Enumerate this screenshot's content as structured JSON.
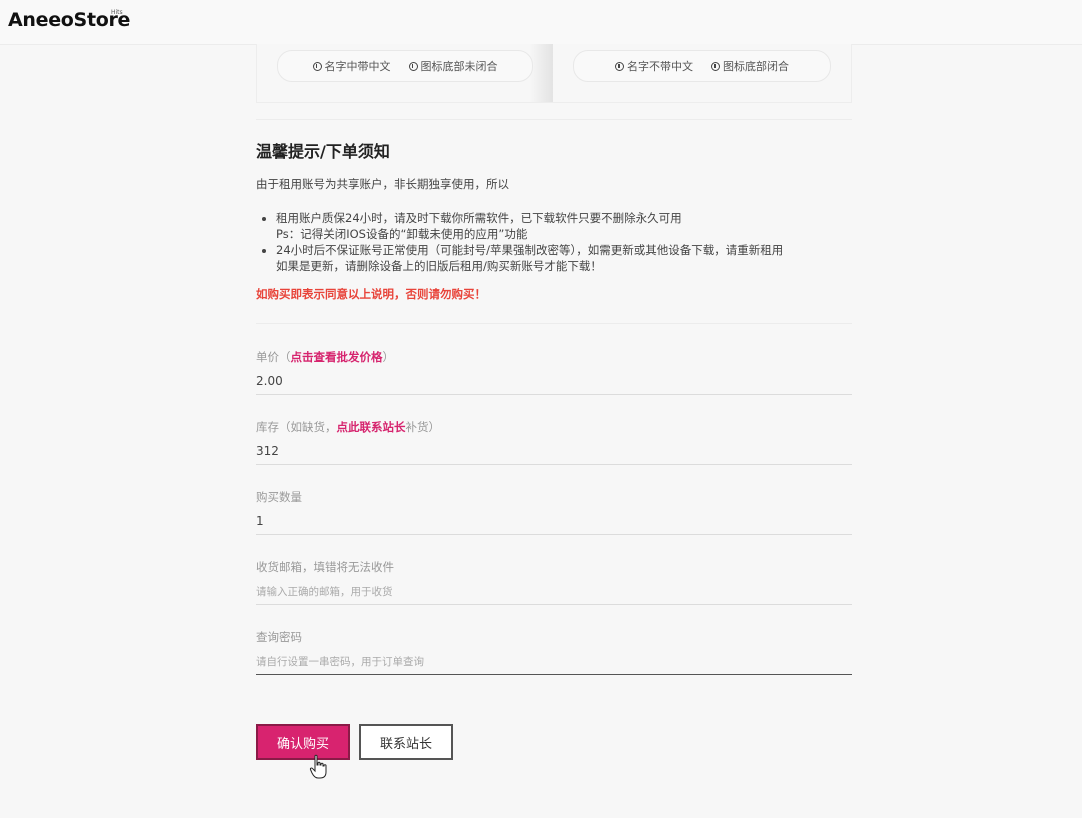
{
  "header": {
    "logo_text": "AneeoStore",
    "logo_superscript": "Hits"
  },
  "preview": {
    "left_pill": [
      "名字中带中文",
      "图标底部未闭合"
    ],
    "right_pill": [
      "名字不带中文",
      "图标底部闭合"
    ]
  },
  "notice": {
    "title": "温馨提示/下单须知",
    "intro": "由于租用账号为共享账户，非长期独享使用，所以",
    "item1_line1": "租用账户质保24小时，请及时下载你所需软件，已下载软件只要不删除永久可用",
    "item1_line2": "Ps：记得关闭IOS设备的“卸载未使用的应用”功能",
    "item2_line1": "24小时后不保证账号正常使用（可能封号/苹果强制改密等），如需更新或其他设备下载，请重新租用",
    "item2_line2": "如果是更新，请删除设备上的旧版后租用/购买新账号才能下载！",
    "warning": "如购买即表示同意以上说明，否则请勿购买！"
  },
  "form": {
    "price": {
      "label_prefix": "单价（",
      "label_link": "点击查看批发价格",
      "label_suffix": "）",
      "value": "2.00"
    },
    "stock": {
      "label_prefix": "库存（如缺货，",
      "label_link": "点此联系站长",
      "label_suffix": "补货）",
      "value": "312"
    },
    "quantity": {
      "label": "购买数量",
      "value": "1"
    },
    "email": {
      "label": "收货邮箱，填错将无法收件",
      "placeholder": "请输入正确的邮箱，用于收货"
    },
    "password": {
      "label": "查询密码",
      "placeholder": "请自行设置一串密码，用于订单查询"
    }
  },
  "buttons": {
    "confirm": "确认购买",
    "contact": "联系站长"
  }
}
